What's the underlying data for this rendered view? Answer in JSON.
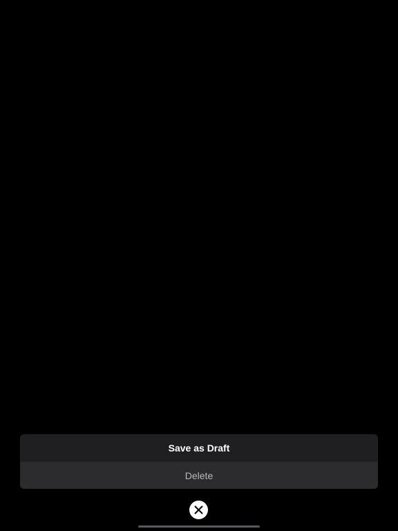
{
  "action_sheet": {
    "save_draft_label": "Save as Draft",
    "delete_label": "Delete"
  },
  "close": {
    "icon": "close-icon"
  },
  "colors": {
    "background": "#000000",
    "sheet_primary": "#1f1f21",
    "sheet_secondary": "#2c2c2e",
    "close_bg": "#ffffff"
  }
}
